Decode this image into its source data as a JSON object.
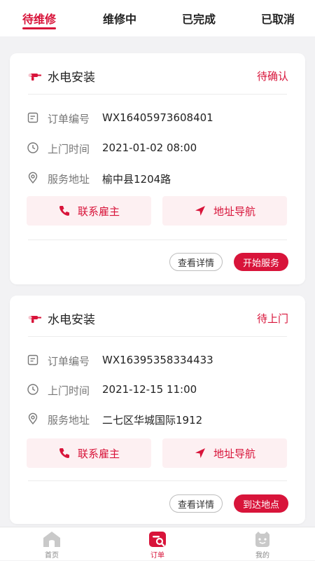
{
  "tabs": [
    {
      "label": "待维修",
      "active": true
    },
    {
      "label": "维修中",
      "active": false
    },
    {
      "label": "已完成",
      "active": false
    },
    {
      "label": "已取消",
      "active": false
    }
  ],
  "orders": [
    {
      "service": "水电安装",
      "status": "待确认",
      "order_no_label": "订单编号",
      "order_no": "WX16405973608401",
      "visit_time_label": "上门时间",
      "visit_time": "2021-01-02 08:00",
      "address_label": "服务地址",
      "address": "榆中县1204路",
      "contact_label": "联系雇主",
      "navigate_label": "地址导航",
      "detail_label": "查看详情",
      "action_label": "开始服务"
    },
    {
      "service": "水电安装",
      "status": "待上门",
      "order_no_label": "订单编号",
      "order_no": "WX16395358334433",
      "visit_time_label": "上门时间",
      "visit_time": "2021-12-15 11:00",
      "address_label": "服务地址",
      "address": "二七区华城国际1912",
      "contact_label": "联系雇主",
      "navigate_label": "地址导航",
      "detail_label": "查看详情",
      "action_label": "到达地点"
    }
  ],
  "bottom_nav": [
    {
      "label": "首页",
      "icon": "home-icon"
    },
    {
      "label": "订单",
      "icon": "orders-icon",
      "active": true
    },
    {
      "label": "我的",
      "icon": "profile-icon"
    }
  ],
  "colors": {
    "accent": "#d8143a",
    "accent_light": "#fdf0f2",
    "background": "#f2f2f4"
  }
}
